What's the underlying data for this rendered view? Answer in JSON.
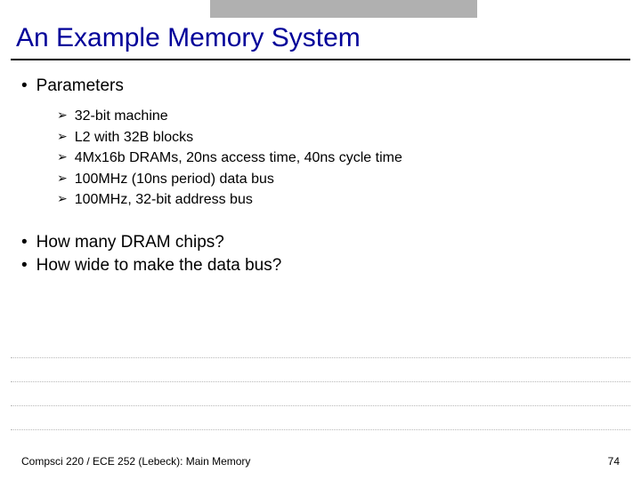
{
  "title": "An Example Memory System",
  "sections": {
    "param_header": "Parameters",
    "params": [
      "32-bit machine",
      "L2 with 32B blocks",
      "4Mx16b DRAMs, 20ns access time, 40ns cycle time",
      "100MHz (10ns period) data bus",
      "100MHz, 32-bit address bus"
    ],
    "questions": [
      "How many DRAM chips?",
      "How wide to make the data bus?"
    ]
  },
  "footer": {
    "left": "Compsci 220 / ECE 252 (Lebeck): Main Memory",
    "right": "74"
  }
}
